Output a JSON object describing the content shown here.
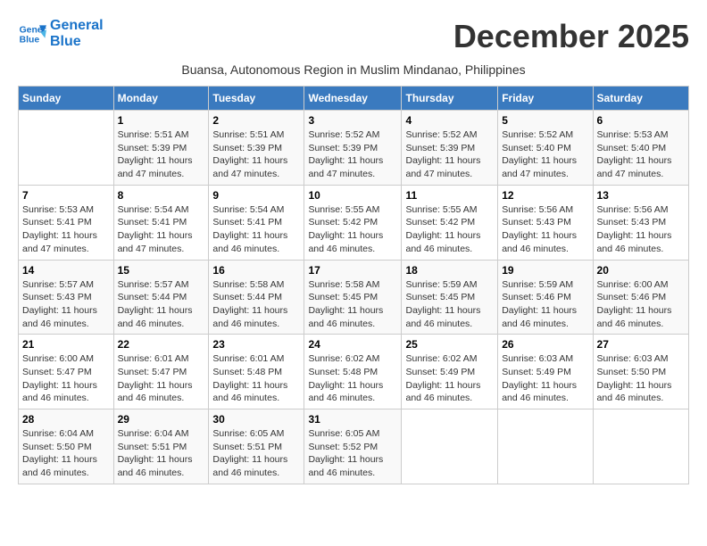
{
  "header": {
    "logo_line1": "General",
    "logo_line2": "Blue",
    "month_title": "December 2025",
    "subtitle": "Buansa, Autonomous Region in Muslim Mindanao, Philippines"
  },
  "days_of_week": [
    "Sunday",
    "Monday",
    "Tuesday",
    "Wednesday",
    "Thursday",
    "Friday",
    "Saturday"
  ],
  "weeks": [
    [
      {
        "day": "",
        "info": ""
      },
      {
        "day": "1",
        "info": "Sunrise: 5:51 AM\nSunset: 5:39 PM\nDaylight: 11 hours\nand 47 minutes."
      },
      {
        "day": "2",
        "info": "Sunrise: 5:51 AM\nSunset: 5:39 PM\nDaylight: 11 hours\nand 47 minutes."
      },
      {
        "day": "3",
        "info": "Sunrise: 5:52 AM\nSunset: 5:39 PM\nDaylight: 11 hours\nand 47 minutes."
      },
      {
        "day": "4",
        "info": "Sunrise: 5:52 AM\nSunset: 5:39 PM\nDaylight: 11 hours\nand 47 minutes."
      },
      {
        "day": "5",
        "info": "Sunrise: 5:52 AM\nSunset: 5:40 PM\nDaylight: 11 hours\nand 47 minutes."
      },
      {
        "day": "6",
        "info": "Sunrise: 5:53 AM\nSunset: 5:40 PM\nDaylight: 11 hours\nand 47 minutes."
      }
    ],
    [
      {
        "day": "7",
        "info": "Sunrise: 5:53 AM\nSunset: 5:41 PM\nDaylight: 11 hours\nand 47 minutes."
      },
      {
        "day": "8",
        "info": "Sunrise: 5:54 AM\nSunset: 5:41 PM\nDaylight: 11 hours\nand 47 minutes."
      },
      {
        "day": "9",
        "info": "Sunrise: 5:54 AM\nSunset: 5:41 PM\nDaylight: 11 hours\nand 46 minutes."
      },
      {
        "day": "10",
        "info": "Sunrise: 5:55 AM\nSunset: 5:42 PM\nDaylight: 11 hours\nand 46 minutes."
      },
      {
        "day": "11",
        "info": "Sunrise: 5:55 AM\nSunset: 5:42 PM\nDaylight: 11 hours\nand 46 minutes."
      },
      {
        "day": "12",
        "info": "Sunrise: 5:56 AM\nSunset: 5:43 PM\nDaylight: 11 hours\nand 46 minutes."
      },
      {
        "day": "13",
        "info": "Sunrise: 5:56 AM\nSunset: 5:43 PM\nDaylight: 11 hours\nand 46 minutes."
      }
    ],
    [
      {
        "day": "14",
        "info": "Sunrise: 5:57 AM\nSunset: 5:43 PM\nDaylight: 11 hours\nand 46 minutes."
      },
      {
        "day": "15",
        "info": "Sunrise: 5:57 AM\nSunset: 5:44 PM\nDaylight: 11 hours\nand 46 minutes."
      },
      {
        "day": "16",
        "info": "Sunrise: 5:58 AM\nSunset: 5:44 PM\nDaylight: 11 hours\nand 46 minutes."
      },
      {
        "day": "17",
        "info": "Sunrise: 5:58 AM\nSunset: 5:45 PM\nDaylight: 11 hours\nand 46 minutes."
      },
      {
        "day": "18",
        "info": "Sunrise: 5:59 AM\nSunset: 5:45 PM\nDaylight: 11 hours\nand 46 minutes."
      },
      {
        "day": "19",
        "info": "Sunrise: 5:59 AM\nSunset: 5:46 PM\nDaylight: 11 hours\nand 46 minutes."
      },
      {
        "day": "20",
        "info": "Sunrise: 6:00 AM\nSunset: 5:46 PM\nDaylight: 11 hours\nand 46 minutes."
      }
    ],
    [
      {
        "day": "21",
        "info": "Sunrise: 6:00 AM\nSunset: 5:47 PM\nDaylight: 11 hours\nand 46 minutes."
      },
      {
        "day": "22",
        "info": "Sunrise: 6:01 AM\nSunset: 5:47 PM\nDaylight: 11 hours\nand 46 minutes."
      },
      {
        "day": "23",
        "info": "Sunrise: 6:01 AM\nSunset: 5:48 PM\nDaylight: 11 hours\nand 46 minutes."
      },
      {
        "day": "24",
        "info": "Sunrise: 6:02 AM\nSunset: 5:48 PM\nDaylight: 11 hours\nand 46 minutes."
      },
      {
        "day": "25",
        "info": "Sunrise: 6:02 AM\nSunset: 5:49 PM\nDaylight: 11 hours\nand 46 minutes."
      },
      {
        "day": "26",
        "info": "Sunrise: 6:03 AM\nSunset: 5:49 PM\nDaylight: 11 hours\nand 46 minutes."
      },
      {
        "day": "27",
        "info": "Sunrise: 6:03 AM\nSunset: 5:50 PM\nDaylight: 11 hours\nand 46 minutes."
      }
    ],
    [
      {
        "day": "28",
        "info": "Sunrise: 6:04 AM\nSunset: 5:50 PM\nDaylight: 11 hours\nand 46 minutes."
      },
      {
        "day": "29",
        "info": "Sunrise: 6:04 AM\nSunset: 5:51 PM\nDaylight: 11 hours\nand 46 minutes."
      },
      {
        "day": "30",
        "info": "Sunrise: 6:05 AM\nSunset: 5:51 PM\nDaylight: 11 hours\nand 46 minutes."
      },
      {
        "day": "31",
        "info": "Sunrise: 6:05 AM\nSunset: 5:52 PM\nDaylight: 11 hours\nand 46 minutes."
      },
      {
        "day": "",
        "info": ""
      },
      {
        "day": "",
        "info": ""
      },
      {
        "day": "",
        "info": ""
      }
    ]
  ]
}
